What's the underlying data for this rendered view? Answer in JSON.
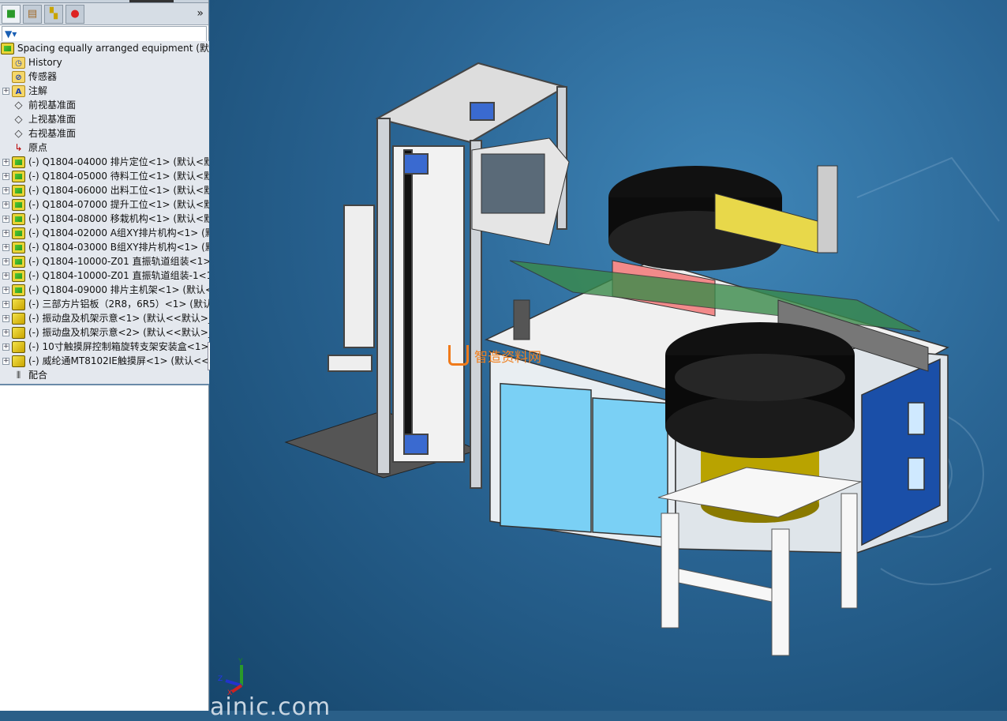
{
  "panel": {
    "tabs": [
      {
        "icon": "feature-manager-icon"
      },
      {
        "icon": "property-manager-icon"
      },
      {
        "icon": "configuration-manager-icon"
      },
      {
        "icon": "display-manager-icon"
      }
    ],
    "more": "»",
    "filter_icon": "filter-icon"
  },
  "tree": {
    "root": "Spacing equally arranged equipment  (默认",
    "items": [
      {
        "label": "History",
        "icon": "history-folder-icon",
        "expandable": false
      },
      {
        "label": "传感器",
        "icon": "sensors-folder-icon",
        "expandable": false
      },
      {
        "label": "注解",
        "icon": "annotations-folder-icon",
        "expandable": true
      },
      {
        "label": "前视基准面",
        "icon": "plane-icon",
        "expandable": false
      },
      {
        "label": "上视基准面",
        "icon": "plane-icon",
        "expandable": false
      },
      {
        "label": "右视基准面",
        "icon": "plane-icon",
        "expandable": false
      },
      {
        "label": "原点",
        "icon": "origin-icon",
        "expandable": false
      },
      {
        "label": "(-) Q1804-04000 排片定位<1> (默认<默",
        "icon": "subassembly-icon",
        "expandable": true
      },
      {
        "label": "(-) Q1804-05000 待料工位<1> (默认<默",
        "icon": "subassembly-icon",
        "expandable": true
      },
      {
        "label": "(-) Q1804-06000 出料工位<1> (默认<默",
        "icon": "subassembly-icon",
        "expandable": true
      },
      {
        "label": "(-) Q1804-07000 提升工位<1> (默认<默",
        "icon": "subassembly-icon",
        "expandable": true
      },
      {
        "label": "(-) Q1804-08000 移栽机构<1> (默认<默",
        "icon": "subassembly-icon",
        "expandable": true
      },
      {
        "label": "(-) Q1804-02000 A组XY排片机构<1> (默",
        "icon": "subassembly-icon",
        "expandable": true
      },
      {
        "label": "(-) Q1804-03000 B组XY排片机构<1> (默",
        "icon": "subassembly-icon",
        "expandable": true
      },
      {
        "label": "(-) Q1804-10000-Z01 直振轨道组装<1>",
        "icon": "subassembly-icon",
        "expandable": true
      },
      {
        "label": "(-) Q1804-10000-Z01 直振轨道组装-1<1",
        "icon": "subassembly-icon",
        "expandable": true
      },
      {
        "label": "(-) Q1804-09000 排片主机架<1> (默认<",
        "icon": "subassembly-icon",
        "expandable": true
      },
      {
        "label": "(-) 三部方片铝板（2R8，6R5）<1> (默认",
        "icon": "part-assembly-icon",
        "expandable": true
      },
      {
        "label": "(-) 振动盘及机架示意<1> (默认<<默认>_",
        "icon": "part-assembly-icon",
        "expandable": true
      },
      {
        "label": "(-) 振动盘及机架示意<2> (默认<<默认>_",
        "icon": "part-assembly-icon",
        "expandable": true
      },
      {
        "label": "(-) 10寸触摸屏控制箱旋转支架安装盒<1>",
        "icon": "part-assembly-icon",
        "expandable": true
      },
      {
        "label": "(-) 威纶通MT8102IE触摸屏<1> (默认<<",
        "icon": "part-assembly-icon",
        "expandable": true
      },
      {
        "label": "配合",
        "icon": "mates-icon",
        "expandable": false
      }
    ]
  },
  "viewport": {
    "watermark": "智造资料网",
    "watermark_bottom": "ainic.com",
    "triad": {
      "x": "X",
      "y": "Y",
      "z": "Z"
    },
    "colors": {
      "background": "#2a6594",
      "frame_blue": "#6fc8f0",
      "bowl": "#111111",
      "bowl_base": "#c8b400"
    }
  }
}
